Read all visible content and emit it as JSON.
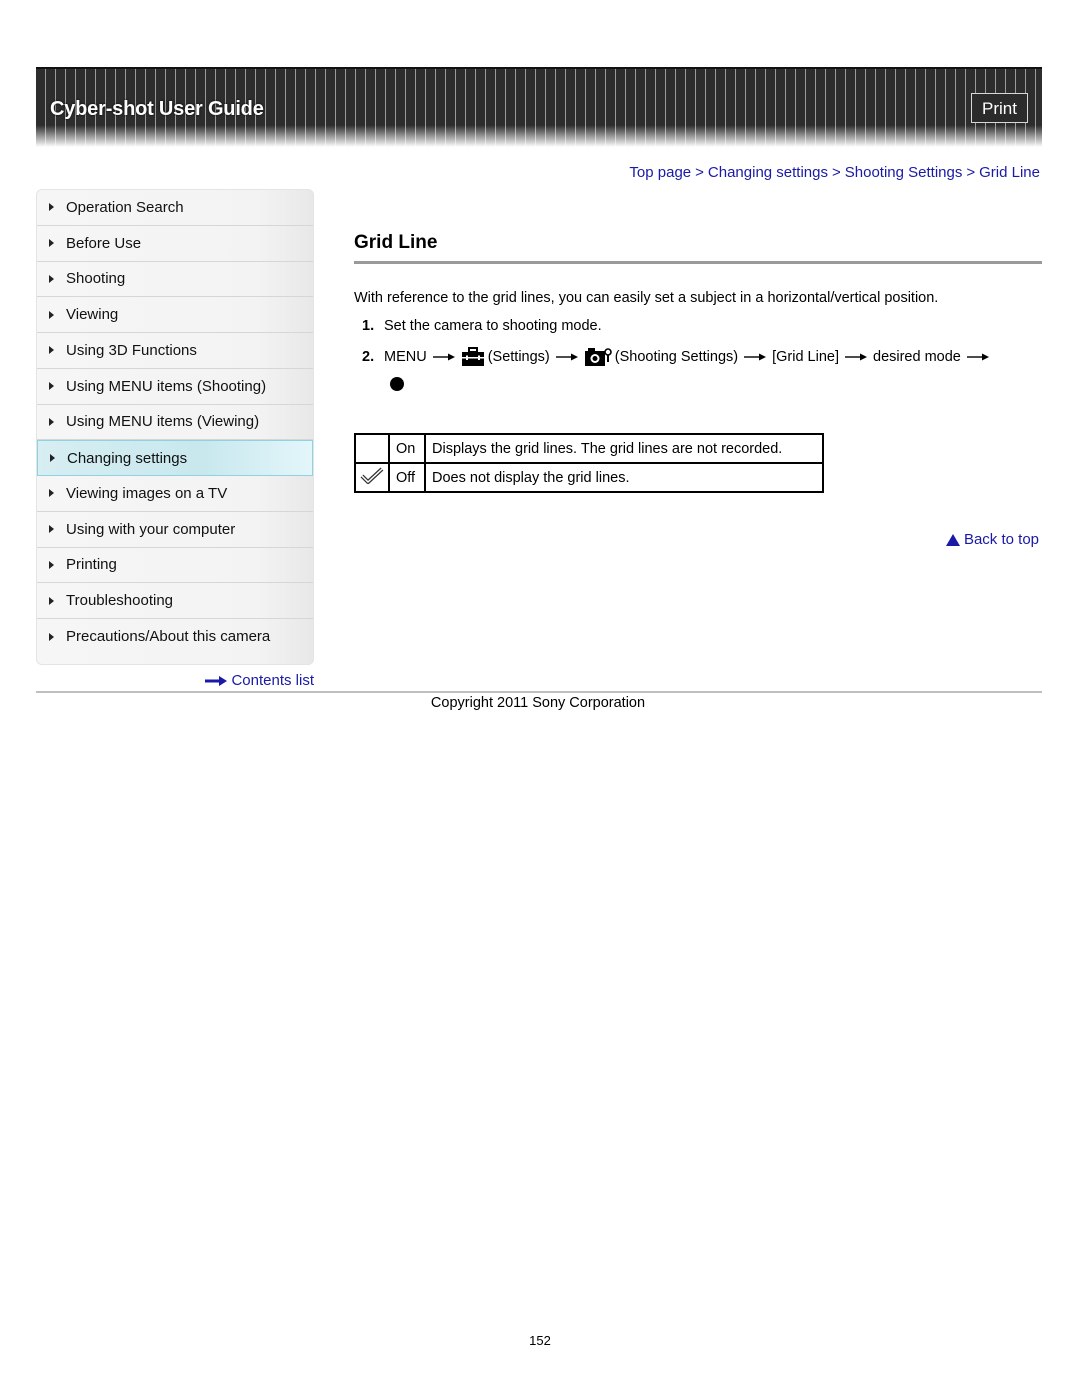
{
  "header": {
    "title": "Cyber-shot User Guide",
    "print_label": "Print"
  },
  "sidebar": {
    "items": [
      {
        "label": "Operation Search",
        "active": false
      },
      {
        "label": "Before Use",
        "active": false
      },
      {
        "label": "Shooting",
        "active": false
      },
      {
        "label": "Viewing",
        "active": false
      },
      {
        "label": "Using 3D Functions",
        "active": false
      },
      {
        "label": "Using MENU items (Shooting)",
        "active": false
      },
      {
        "label": "Using MENU items (Viewing)",
        "active": false
      },
      {
        "label": "Changing settings",
        "active": true
      },
      {
        "label": "Viewing images on a TV",
        "active": false
      },
      {
        "label": "Using with your computer",
        "active": false
      },
      {
        "label": "Printing",
        "active": false
      },
      {
        "label": "Troubleshooting",
        "active": false
      },
      {
        "label": "Precautions/About this camera",
        "active": false
      }
    ],
    "contents_link": "Contents list"
  },
  "breadcrumb": {
    "items": [
      "Top page",
      "Changing settings",
      "Shooting Settings",
      "Grid Line"
    ],
    "separator": ">"
  },
  "main": {
    "title": "Grid Line",
    "intro": "With reference to the grid lines, you can easily set a subject in a horizontal/vertical position.",
    "steps": [
      {
        "num": "1.",
        "text": "Set the camera to shooting mode."
      },
      {
        "num": "2.",
        "menu": "MENU",
        "settings": "(Settings)",
        "shooting_settings": "(Shooting Settings)",
        "grid_line": "[Grid Line]",
        "desired_mode": "desired mode",
        "icons": [
          "toolbox-settings-icon",
          "camera-settings-icon",
          "right-arrow-icon",
          "bullet-icon"
        ]
      }
    ],
    "modes_table": [
      {
        "default": false,
        "mode": "On",
        "description": "Displays the grid lines. The grid lines are not recorded."
      },
      {
        "default": true,
        "mode": "Off",
        "description": "Does not display the grid lines."
      }
    ],
    "back_to_top": "Back to top"
  },
  "footer": {
    "copyright": "Copyright 2011 Sony Corporation",
    "page_number": "152"
  },
  "colors": {
    "link": "#1a1aa6",
    "header_bg": "#2f2f2f",
    "active_item": "#c8e8ee"
  }
}
